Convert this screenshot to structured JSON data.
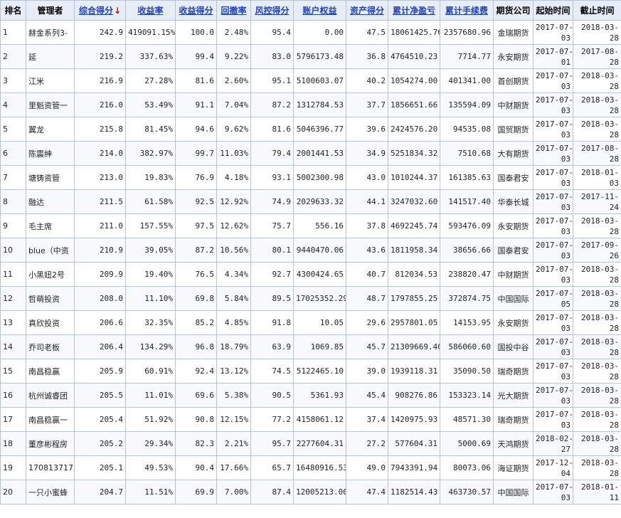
{
  "colors": {
    "header_bg": "#e6edf6",
    "link": "#1f3fbf",
    "profit_red": "#cc0000",
    "sort_arrow": "#d40000",
    "grid": "#b9c2cf"
  },
  "headers": {
    "rank": "排名",
    "manager": "管理者",
    "composite": "综合得分",
    "sort_arrow": "↓",
    "return_rate": "收益率",
    "return_score": "收益得分",
    "drawdown": "回撤率",
    "risk_score": "风控得分",
    "equity": "账户权益",
    "asset_score": "资产得分",
    "net_profit": "累计净盈亏",
    "fees": "累计手续费",
    "broker": "期货公司",
    "start": "起始时间",
    "end": "截止时间"
  },
  "rows": [
    {
      "rank": "1",
      "manager": "赫金系列3-",
      "composite": "242.9",
      "return_rate": "419091.15%",
      "return_score": "100.0",
      "drawdown": "2.48%",
      "risk_score": "95.4",
      "equity": "0.00",
      "asset_score": "47.5",
      "net_profit": "18061425.76",
      "fees": "2357680.96",
      "broker": "金瑞期货",
      "start_a": "2017-07-",
      "start_b": "03",
      "end_a": "2018-03-",
      "end_b": "28"
    },
    {
      "rank": "2",
      "manager": "延",
      "composite": "219.2",
      "return_rate": "337.63%",
      "return_score": "99.4",
      "drawdown": "9.22%",
      "risk_score": "83.0",
      "equity": "5796173.48",
      "asset_score": "36.8",
      "net_profit": "4764510.23",
      "fees": "7714.77",
      "broker": "永安期货",
      "start_a": "2017-07-",
      "start_b": "01",
      "end_a": "2017-08-",
      "end_b": "28"
    },
    {
      "rank": "3",
      "manager": "江米",
      "composite": "216.9",
      "return_rate": "27.28%",
      "return_score": "81.6",
      "drawdown": "2.60%",
      "risk_score": "95.1",
      "equity": "5100603.07",
      "asset_score": "40.2",
      "net_profit": "1054274.00",
      "fees": "401341.00",
      "broker": "首创期货",
      "start_a": "2017-07-",
      "start_b": "03",
      "end_a": "2018-03-",
      "end_b": "28"
    },
    {
      "rank": "4",
      "manager": "里魁资管一",
      "composite": "216.0",
      "return_rate": "53.49%",
      "return_score": "91.1",
      "drawdown": "7.04%",
      "risk_score": "87.2",
      "equity": "1312784.53",
      "asset_score": "37.7",
      "net_profit": "1856651.66",
      "fees": "135594.09",
      "broker": "中财期货",
      "start_a": "2017-07-",
      "start_b": "03",
      "end_a": "2018-03-",
      "end_b": "28"
    },
    {
      "rank": "5",
      "manager": "翼龙",
      "composite": "215.8",
      "return_rate": "81.45%",
      "return_score": "94.6",
      "drawdown": "9.62%",
      "risk_score": "81.6",
      "equity": "5046396.77",
      "asset_score": "39.6",
      "net_profit": "2424576.20",
      "fees": "94535.08",
      "broker": "国贸期货",
      "start_a": "2017-07-",
      "start_b": "03",
      "end_a": "2018-03-",
      "end_b": "28"
    },
    {
      "rank": "6",
      "manager": "陈震绅",
      "composite": "214.0",
      "return_rate": "382.97%",
      "return_score": "99.7",
      "drawdown": "11.03%",
      "risk_score": "79.4",
      "equity": "2001441.53",
      "asset_score": "34.9",
      "net_profit": "5251834.32",
      "fees": "7510.68",
      "broker": "大有期货",
      "start_a": "2017-07-",
      "start_b": "03",
      "end_a": "2017-08-",
      "end_b": "28"
    },
    {
      "rank": "7",
      "manager": "塘铸资管",
      "composite": "213.0",
      "return_rate": "19.83%",
      "return_score": "76.9",
      "drawdown": "4.18%",
      "risk_score": "93.1",
      "equity": "5002300.98",
      "asset_score": "43.0",
      "net_profit": "1010244.37",
      "fees": "161385.63",
      "broker": "国泰君安",
      "start_a": "2017-07-",
      "start_b": "03",
      "end_a": "2018-01-",
      "end_b": "03"
    },
    {
      "rank": "8",
      "manager": "融达",
      "composite": "211.5",
      "return_rate": "61.58%",
      "return_score": "92.5",
      "drawdown": "12.92%",
      "risk_score": "74.9",
      "equity": "2029633.32",
      "asset_score": "44.1",
      "net_profit": "3247032.60",
      "fees": "141517.40",
      "broker": "华泰长城",
      "start_a": "2017-07-",
      "start_b": "03",
      "end_a": "2017-11-",
      "end_b": "24"
    },
    {
      "rank": "9",
      "manager": "毛主席",
      "composite": "211.0",
      "return_rate": "157.55%",
      "return_score": "97.5",
      "drawdown": "12.62%",
      "risk_score": "75.7",
      "equity": "556.16",
      "asset_score": "37.8",
      "net_profit": "4692245.74",
      "fees": "593476.09",
      "broker": "永安期货",
      "start_a": "2017-07-",
      "start_b": "03",
      "end_a": "2018-03-",
      "end_b": "28"
    },
    {
      "rank": "10",
      "manager": "blue（中资",
      "composite": "210.9",
      "return_rate": "39.05%",
      "return_score": "87.2",
      "drawdown": "10.56%",
      "risk_score": "80.1",
      "equity": "9440470.06",
      "asset_score": "43.6",
      "net_profit": "1811958.34",
      "fees": "38656.66",
      "broker": "国泰君安",
      "start_a": "2017-07-",
      "start_b": "03",
      "end_a": "2017-09-",
      "end_b": "26"
    },
    {
      "rank": "11",
      "manager": "小黑妞2号",
      "composite": "209.9",
      "return_rate": "19.40%",
      "return_score": "76.5",
      "drawdown": "4.34%",
      "risk_score": "92.7",
      "equity": "4300424.65",
      "asset_score": "40.7",
      "net_profit": "812034.53",
      "fees": "238820.47",
      "broker": "中财期货",
      "start_a": "2017-07-",
      "start_b": "03",
      "end_a": "2018-03-",
      "end_b": "28"
    },
    {
      "rank": "12",
      "manager": "哲萌投资",
      "composite": "208.0",
      "return_rate": "11.10%",
      "return_score": "69.8",
      "drawdown": "5.84%",
      "risk_score": "89.5",
      "equity": "17025352.29",
      "asset_score": "48.7",
      "net_profit": "1797855.25",
      "fees": "372874.75",
      "broker": "中国国际",
      "start_a": "2017-07-",
      "start_b": "05",
      "end_a": "2018-03-",
      "end_b": "28"
    },
    {
      "rank": "13",
      "manager": "真欣投资",
      "composite": "206.6",
      "return_rate": "32.35%",
      "return_score": "85.2",
      "drawdown": "4.85%",
      "risk_score": "91.8",
      "equity": "10.05",
      "asset_score": "29.6",
      "net_profit": "2957801.05",
      "fees": "14153.95",
      "broker": "永安期货",
      "start_a": "2017-07-",
      "start_b": "03",
      "end_a": "2018-03-",
      "end_b": "28"
    },
    {
      "rank": "14",
      "manager": "乔司老板",
      "composite": "206.4",
      "return_rate": "134.29%",
      "return_score": "96.8",
      "drawdown": "18.79%",
      "risk_score": "63.9",
      "equity": "1069.85",
      "asset_score": "45.7",
      "net_profit": "21309669.40",
      "fees": "586060.60",
      "broker": "国投中谷",
      "start_a": "2017-07-",
      "start_b": "03",
      "end_a": "2018-03-",
      "end_b": "28"
    },
    {
      "rank": "15",
      "manager": "南昌稳赢",
      "composite": "205.9",
      "return_rate": "60.91%",
      "return_score": "92.4",
      "drawdown": "13.12%",
      "risk_score": "74.5",
      "equity": "5122465.10",
      "asset_score": "39.0",
      "net_profit": "1939118.31",
      "fees": "35090.50",
      "broker": "瑞奇期货",
      "start_a": "2017-07-",
      "start_b": "03",
      "end_a": "2018-03-",
      "end_b": "28"
    },
    {
      "rank": "16",
      "manager": "杭州诚睿团",
      "composite": "205.5",
      "return_rate": "11.01%",
      "return_score": "69.6",
      "drawdown": "5.38%",
      "risk_score": "90.5",
      "equity": "5361.93",
      "asset_score": "45.4",
      "net_profit": "908276.86",
      "fees": "153323.14",
      "broker": "光大期货",
      "start_a": "2017-07-",
      "start_b": "03",
      "end_a": "2018-03-",
      "end_b": "28"
    },
    {
      "rank": "17",
      "manager": "南昌稳赢一",
      "composite": "205.4",
      "return_rate": "51.92%",
      "return_score": "90.8",
      "drawdown": "12.15%",
      "risk_score": "77.2",
      "equity": "4158061.12",
      "asset_score": "37.4",
      "net_profit": "1420975.93",
      "fees": "48571.30",
      "broker": "瑞奇期货",
      "start_a": "2017-07-",
      "start_b": "03",
      "end_a": "2018-03-",
      "end_b": "28"
    },
    {
      "rank": "18",
      "manager": "董彦彬程房",
      "composite": "205.2",
      "return_rate": "29.34%",
      "return_score": "82.3",
      "drawdown": "2.21%",
      "risk_score": "95.7",
      "equity": "2277604.31",
      "asset_score": "27.2",
      "net_profit": "577604.31",
      "fees": "5000.69",
      "broker": "天鸿期货",
      "start_a": "2018-02-",
      "start_b": "27",
      "end_a": "2018-03-",
      "end_b": "28"
    },
    {
      "rank": "19",
      "manager": "170813717",
      "composite": "205.1",
      "return_rate": "49.53%",
      "return_score": "90.4",
      "drawdown": "17.66%",
      "risk_score": "65.7",
      "equity": "16480916.53",
      "asset_score": "49.0",
      "net_profit": "7943391.94",
      "fees": "80073.06",
      "broker": "海证期货",
      "start_a": "2017-12-",
      "start_b": "04",
      "end_a": "2018-03-",
      "end_b": "28"
    },
    {
      "rank": "20",
      "manager": "一只小蜜蜂",
      "composite": "204.7",
      "return_rate": "11.51%",
      "return_score": "69.9",
      "drawdown": "7.00%",
      "risk_score": "87.4",
      "equity": "12005213.00",
      "asset_score": "47.4",
      "net_profit": "1182514.43",
      "fees": "463730.57",
      "broker": "中国国际",
      "start_a": "2017-07-",
      "start_b": "03",
      "end_a": "2018-01-",
      "end_b": "11"
    }
  ]
}
